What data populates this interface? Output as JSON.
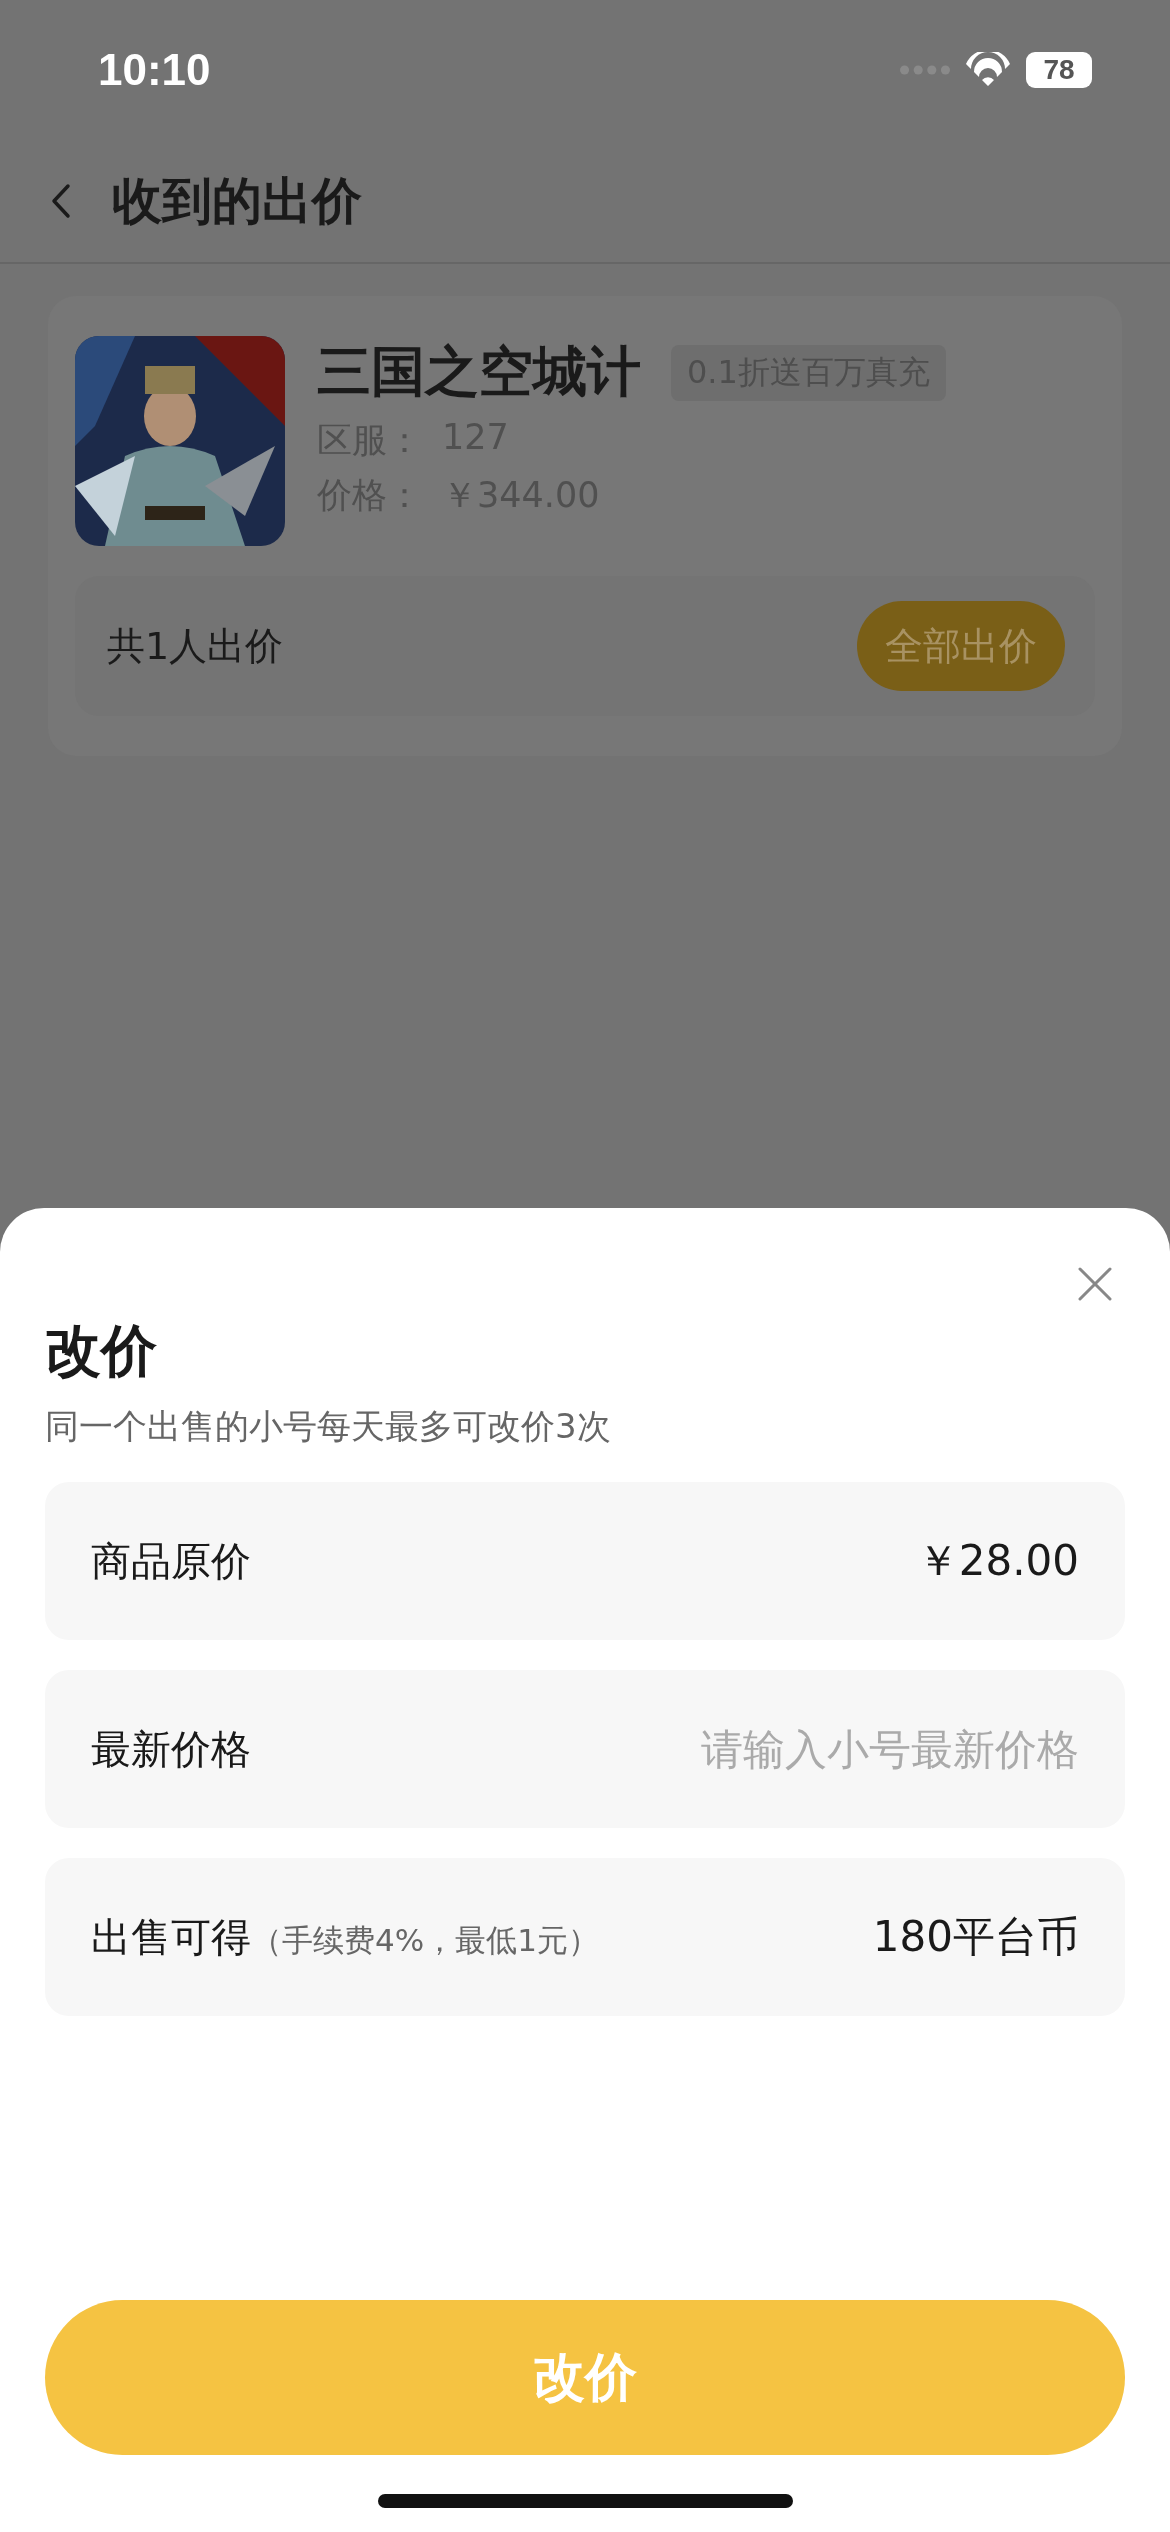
{
  "status_bar": {
    "time": "10:10",
    "battery": "78"
  },
  "nav": {
    "title": "收到的出价"
  },
  "listing": {
    "title": "三国之空城计",
    "tag": "0.1折送百万真充",
    "server_label": "区服：",
    "server": "127",
    "price_label": "价格：",
    "price": "￥344.00",
    "offers": "共1人出价",
    "button": "全部出价"
  },
  "sheet": {
    "title": "改价",
    "subtitle": "同一个出售的小号每天最多可改价3次",
    "rows": [
      {
        "kind": "value",
        "label": "商品原价",
        "value": "￥28.00"
      },
      {
        "kind": "input",
        "label": "最新价格",
        "placeholder": "请输入小号最新价格"
      },
      {
        "kind": "value",
        "label": "出售可得",
        "note": "（手续费4%，最低1元）",
        "value": "180平台币"
      }
    ],
    "button": "改价"
  }
}
